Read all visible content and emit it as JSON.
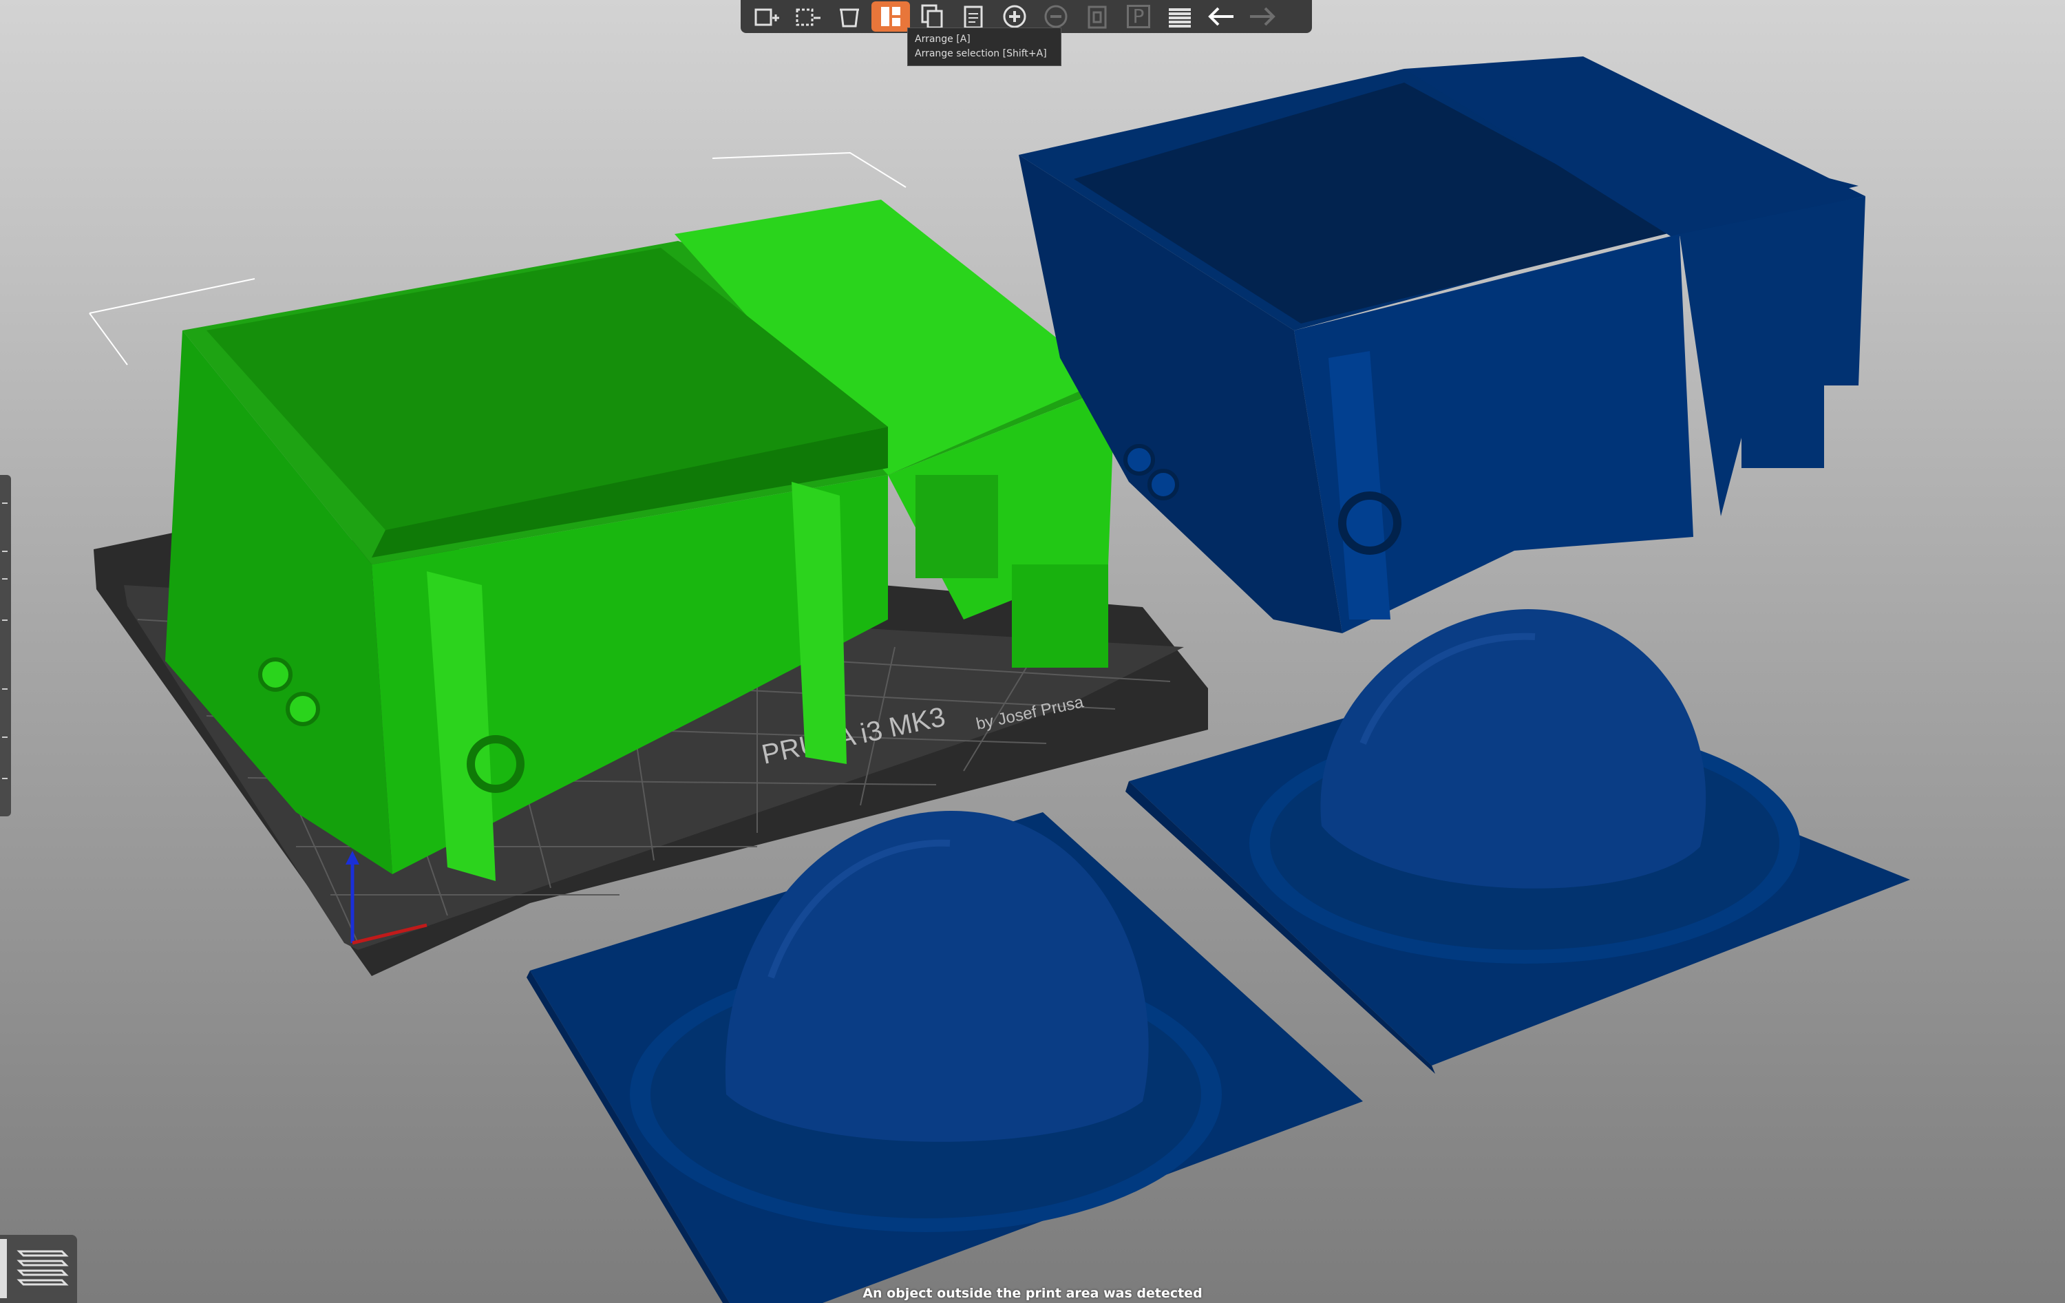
{
  "toolbar": {
    "buttons": [
      {
        "name": "add-icon",
        "label": "",
        "enabled": true
      },
      {
        "name": "delete-icon",
        "label": "",
        "enabled": true
      },
      {
        "name": "delete-all-icon",
        "label": "",
        "enabled": true
      },
      {
        "name": "arrange-icon",
        "label": "",
        "enabled": true,
        "active": true
      },
      {
        "name": "copy-icon",
        "label": "",
        "enabled": true
      },
      {
        "name": "paste-icon",
        "label": "",
        "enabled": true
      },
      {
        "name": "add-instance-icon",
        "label": "",
        "enabled": true
      },
      {
        "name": "remove-instance-icon",
        "label": "",
        "enabled": false
      },
      {
        "name": "split-objects-icon",
        "label": "",
        "enabled": false
      },
      {
        "name": "split-parts-icon",
        "label": "P",
        "enabled": false
      },
      {
        "name": "layers-editing-icon",
        "label": "",
        "enabled": true
      },
      {
        "name": "undo-icon",
        "label": "",
        "enabled": true
      },
      {
        "name": "redo-icon",
        "label": "",
        "enabled": false
      }
    ]
  },
  "tooltip": {
    "line1": "Arrange [A]",
    "line2": "Arrange selection [Shift+A]"
  },
  "bed": {
    "brand": "PRUSA i3 MK3",
    "subtitle": "by Josef Prusa",
    "bed_color": "#2f2f2f",
    "grid_color": "#555555"
  },
  "objects": {
    "selected_color": "#19b70f",
    "unselected_color": "#012f6e",
    "highlight_color": "#22d60f"
  },
  "status": {
    "warning": "An object outside the print area was detected"
  }
}
